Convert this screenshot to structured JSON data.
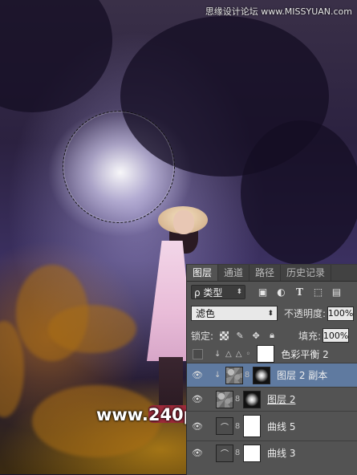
{
  "watermark": {
    "top": "思缘设计论坛 www.MISSYUAN.com",
    "center": "www.240ps.com"
  },
  "panel": {
    "tabs": [
      "图层",
      "通道",
      "路径",
      "历史记录"
    ],
    "active_tab": "图层",
    "kind_filter": "ρ 类型",
    "blend_mode": "滤色",
    "opacity_label": "不透明度:",
    "opacity_value": "100%",
    "lock_label": "锁定:",
    "fill_label": "填充:",
    "fill_value": "100%"
  },
  "layers": [
    {
      "name": "色彩平衡 2",
      "visible": false,
      "selected": false
    },
    {
      "name": "图层 2 副本",
      "visible": true,
      "selected": true
    },
    {
      "name": "图层 2",
      "visible": true,
      "selected": false
    },
    {
      "name": "曲线 5",
      "visible": true,
      "selected": false
    },
    {
      "name": "曲线 3",
      "visible": true,
      "selected": false
    }
  ]
}
